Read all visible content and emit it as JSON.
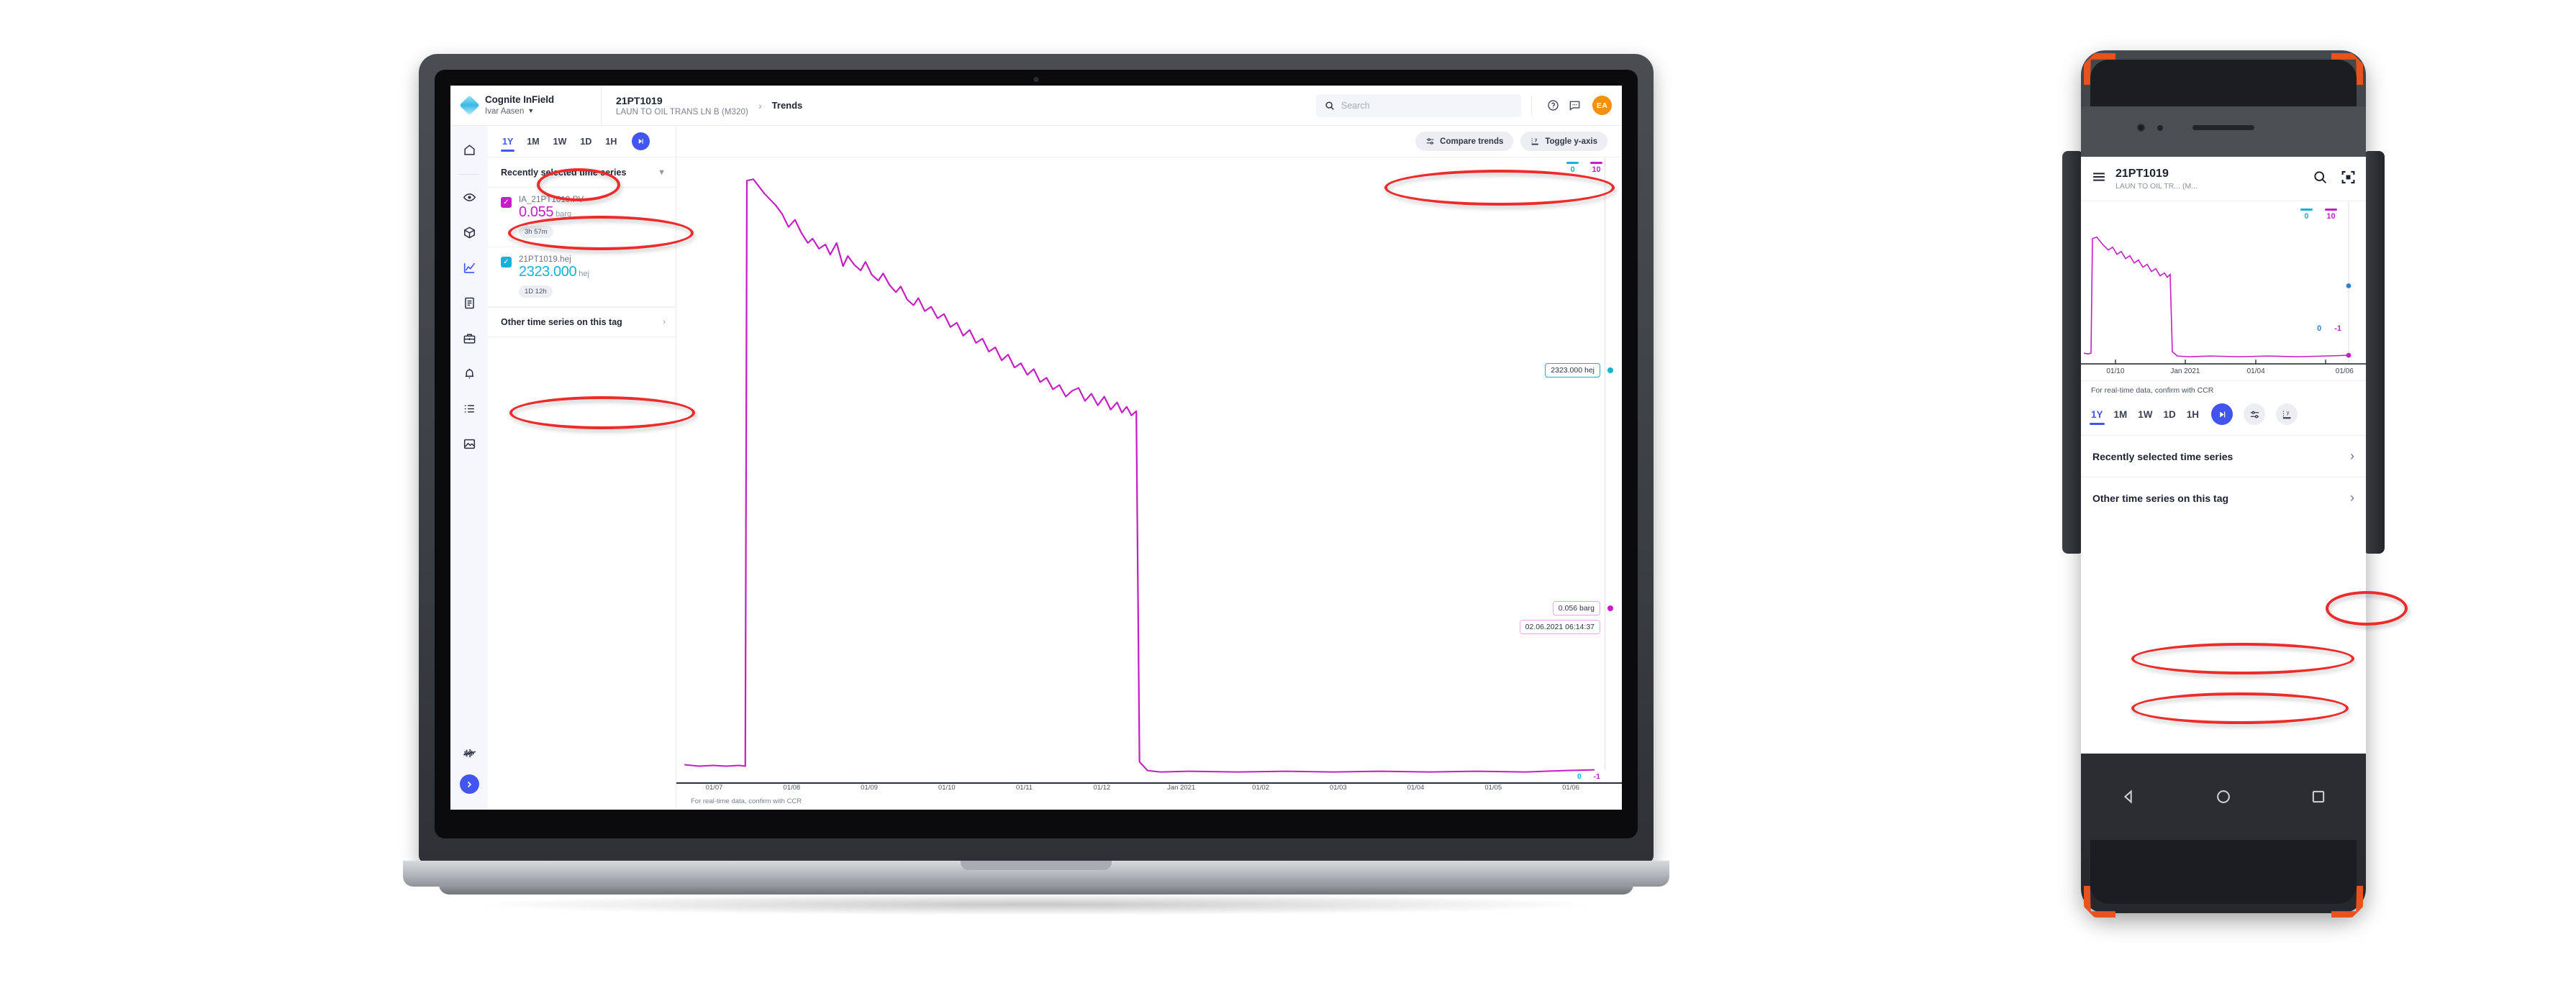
{
  "desktop": {
    "brand": {
      "name": "Cognite InField",
      "account": "Ivar Aasen",
      "logo_icon": "cognite-logo",
      "caret_icon": "chevron-down-icon"
    },
    "breadcrumb": {
      "tag": "21PT1019",
      "tag_description": "LAUN TO OIL TRANS LN B (M320)",
      "separator_icon": "chevron-right-icon",
      "current": "Trends"
    },
    "search": {
      "placeholder": "Search",
      "icon": "search-icon"
    },
    "header_icons": [
      "help-circle-icon",
      "chat-icon"
    ],
    "avatar": {
      "initials": "EA",
      "color": "#f79009"
    },
    "rail": [
      {
        "name": "home-icon",
        "active": false
      },
      {
        "name": "eye-icon",
        "active": false
      },
      {
        "name": "cube-icon",
        "active": false
      },
      {
        "name": "trend-chart-icon",
        "active": true
      },
      {
        "name": "document-icon",
        "active": false
      },
      {
        "name": "toolbox-icon",
        "active": false
      },
      {
        "name": "bell-icon",
        "active": false
      },
      {
        "name": "list-icon",
        "active": false
      },
      {
        "name": "image-icon",
        "active": false
      },
      {
        "name": "waveform-icon",
        "active": false
      }
    ],
    "rail_fab_icon": "chevron-right-icon",
    "ranges": [
      {
        "label": "1Y",
        "active": true
      },
      {
        "label": "1M",
        "active": false
      },
      {
        "label": "1W",
        "active": false
      },
      {
        "label": "1D",
        "active": false
      },
      {
        "label": "1H",
        "active": false
      }
    ],
    "play_icon": "skip-to-now-icon",
    "panel": {
      "recent_header": "Recently selected time series",
      "recent_collapse_icon": "chevron-down-icon",
      "series": [
        {
          "name": "IA_21PT1019.PV",
          "value": "0.055",
          "unit": "barg",
          "chip": "3h 57m",
          "color": "#c41ec4",
          "checked": true
        },
        {
          "name": "21PT1019.hej",
          "value": "2323.000",
          "unit": "hej",
          "chip": "1D 12h",
          "color": "#18b0d8",
          "checked": true
        }
      ],
      "other_header": "Other time series on this tag",
      "other_expand_icon": "chevron-right-icon"
    },
    "toolbar": [
      {
        "label": "Compare trends",
        "icon": "sliders-icon"
      },
      {
        "label": "Toggle y-axis",
        "icon": "y-axis-icon"
      }
    ],
    "chart_footer_note": "For real-time data, confirm with CCR",
    "callouts": [
      {
        "text": "2323.000 hej",
        "color": "#18b0d8"
      },
      {
        "text": "0.056 barg",
        "color": "#c41ec4"
      },
      {
        "text": "02.06.2021 06:14:37",
        "color": "#c41ec4"
      }
    ],
    "axis_bottom": [
      {
        "value": "0",
        "color": "#18b0d8"
      },
      {
        "value": "-1",
        "color": "#c41ec4"
      }
    ]
  },
  "phone": {
    "menu_icon": "hamburger-icon",
    "title": "21PT1019",
    "subtitle": "LAUN TO OIL TR...  (M...",
    "search_icon": "search-icon",
    "scan_icon": "scan-icon",
    "note": "For real-time data, confirm with CCR",
    "ranges": [
      {
        "label": "1Y",
        "active": true
      },
      {
        "label": "1M",
        "active": false
      },
      {
        "label": "1W",
        "active": false
      },
      {
        "label": "1D",
        "active": false
      },
      {
        "label": "1H",
        "active": false
      }
    ],
    "play_icon": "skip-to-now-icon",
    "tool_icons": [
      "sliders-icon",
      "y-axis-icon"
    ],
    "rows": [
      {
        "label": "Recently selected time series",
        "icon": "chevron-right-icon"
      },
      {
        "label": "Other time series on this tag",
        "icon": "chevron-right-icon"
      }
    ],
    "nav": [
      "back-icon",
      "home-icon",
      "recents-icon"
    ],
    "axis_bottom": [
      {
        "value": "0",
        "color": "#2f7fd0"
      },
      {
        "value": "-1",
        "color": "#c41ec4"
      }
    ]
  },
  "chart_data": {
    "type": "line",
    "title": "",
    "xlabel": "",
    "ylabel": "",
    "grid": false,
    "legend_position": "top-right",
    "x_ticks": [
      "01/07",
      "01/08",
      "01/09",
      "01/10",
      "01/11",
      "01/12",
      "Jan 2021",
      "01/02",
      "01/03",
      "01/04",
      "01/05",
      "01/06"
    ],
    "top_axis_labels": [
      {
        "value": "0",
        "color": "#18b0d8"
      },
      {
        "value": "10",
        "color": "#c41ec4"
      }
    ],
    "bottom_axis_labels": [
      {
        "value": "0",
        "color": "#18b0d8"
      },
      {
        "value": "-1",
        "color": "#c41ec4"
      }
    ],
    "series": [
      {
        "name": "IA_21PT1019.PV",
        "unit": "barg",
        "color": "#c41ec4",
        "last_value": 0.056,
        "last_label": "0.056 barg",
        "last_timestamp": "02.06.2021 06:14:37",
        "description": "Flat near baseline until 01/07, steps up to peak ~9.6, decays slowly to ~7.4 by 01/09, drops back to baseline ~0.05 and stays flat through 01/06",
        "x": [
          0,
          3,
          5,
          5.2,
          6,
          9,
          12,
          15,
          17,
          17.6,
          18,
          22,
          30,
          40,
          50,
          60,
          70,
          80,
          90,
          100
        ],
        "y": [
          0.05,
          0.05,
          0.05,
          9.6,
          9.2,
          8.6,
          8.2,
          7.8,
          7.5,
          7.4,
          0.06,
          0.055,
          0.056,
          0.056,
          0.055,
          0.056,
          0.056,
          0.055,
          0.056,
          0.056
        ]
      },
      {
        "name": "21PT1019.hej",
        "unit": "hej",
        "color": "#18b0d8",
        "last_value": 2323.0,
        "last_label": "2323.000 hej",
        "description": "Single data point marker at right edge",
        "x": [
          100
        ],
        "y": [
          2323.0
        ]
      }
    ]
  }
}
